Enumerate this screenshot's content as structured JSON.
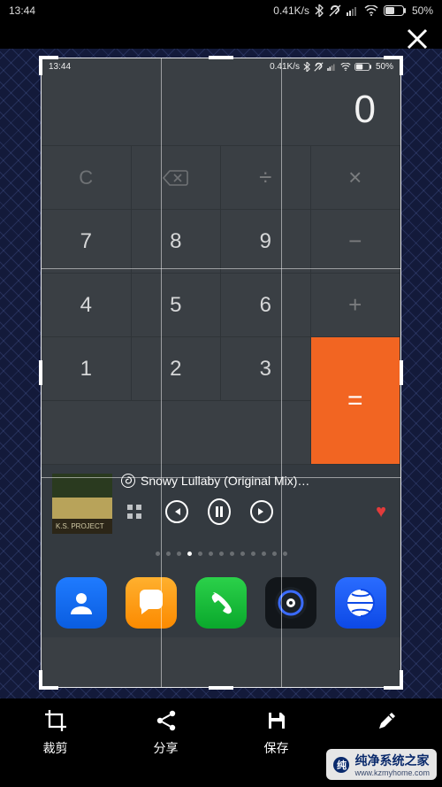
{
  "status": {
    "time": "13:44",
    "speed": "0.41K/s",
    "battery": "50%"
  },
  "inner_status": {
    "time": "13:44",
    "speed": "0.41K/s",
    "battery": "50%"
  },
  "calculator": {
    "display": "0",
    "keys": {
      "clear": "C",
      "divide": "÷",
      "multiply": "×",
      "minus": "−",
      "plus": "+",
      "equals": "=",
      "n7": "7",
      "n8": "8",
      "n9": "9",
      "n4": "4",
      "n5": "5",
      "n6": "6",
      "n1": "1",
      "n2": "2",
      "n3": "3"
    }
  },
  "music": {
    "track": "Snowy Lullaby (Original Mix)…",
    "album_text": "K.S. PROJECT"
  },
  "pager": {
    "count": 13,
    "active_index": 3
  },
  "toolbar": {
    "crop": "裁剪",
    "share": "分享",
    "save": "保存"
  },
  "watermark": {
    "brand": "纯净系统之家",
    "url": "www.kzmyhome.com"
  }
}
